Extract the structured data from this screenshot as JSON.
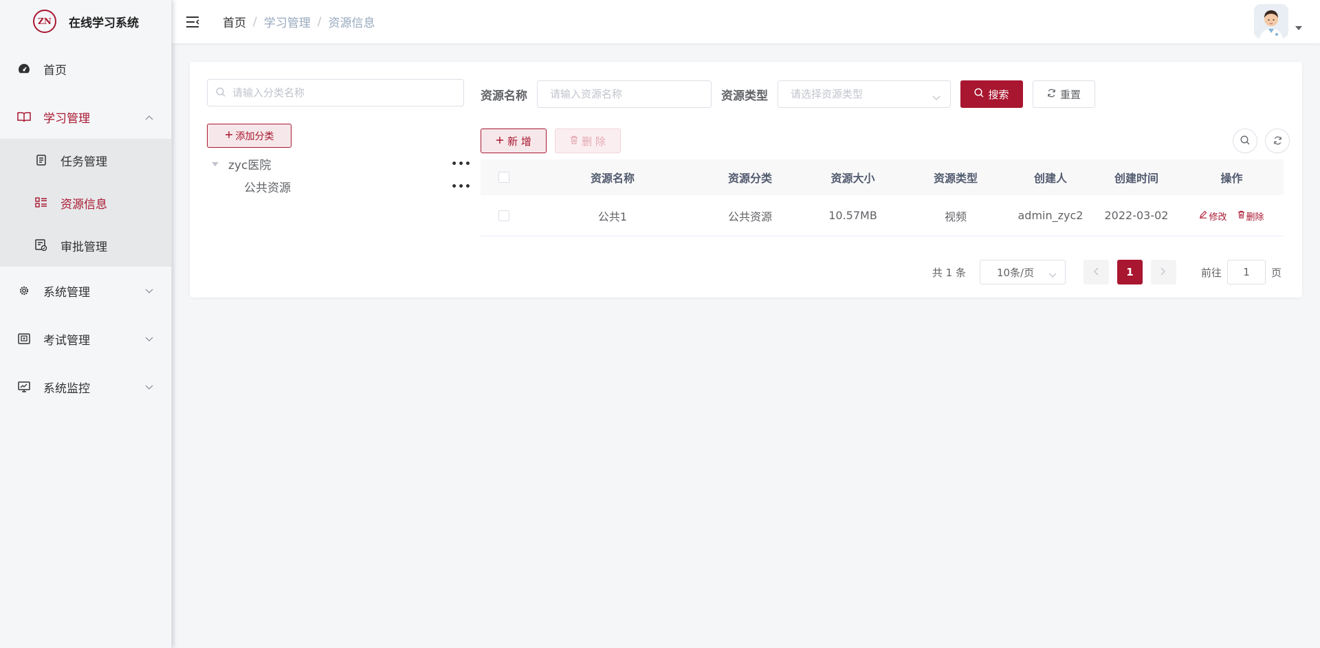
{
  "app": {
    "title": "在线学习系统",
    "logo_text": "ZN"
  },
  "colors": {
    "primary": "#a8162f",
    "sidebar_bg": "#f5f6f8",
    "page_bg": "#f5f6f8"
  },
  "sidebar": {
    "items": [
      {
        "label": "首页",
        "icon": "dashboard-icon"
      },
      {
        "label": "学习管理",
        "icon": "book-icon",
        "expanded": true,
        "children": [
          {
            "label": "任务管理",
            "icon": "task-icon"
          },
          {
            "label": "资源信息",
            "icon": "resource-icon",
            "active": true
          },
          {
            "label": "审批管理",
            "icon": "approval-icon"
          }
        ]
      },
      {
        "label": "系统管理",
        "icon": "gear-icon"
      },
      {
        "label": "考试管理",
        "icon": "exam-icon"
      },
      {
        "label": "系统监控",
        "icon": "monitor-icon"
      }
    ]
  },
  "breadcrumb": {
    "home": "首页",
    "sep": "/",
    "level2": "学习管理",
    "level3": "资源信息"
  },
  "tree": {
    "search_placeholder": "请输入分类名称",
    "add_button": "添加分类",
    "nodes": [
      {
        "label": "zyc医院",
        "dots": "•••"
      },
      {
        "label": "公共资源",
        "dots": "•••"
      }
    ]
  },
  "filters": {
    "name_label": "资源名称",
    "name_placeholder": "请输入资源名称",
    "type_label": "资源类型",
    "type_placeholder": "请选择资源类型",
    "search_button": "搜索",
    "reset_button": "重置"
  },
  "toolbar": {
    "new_button": "新 增",
    "delete_button": "删 除"
  },
  "table": {
    "headers": [
      "资源名称",
      "资源分类",
      "资源大小",
      "资源类型",
      "创建人",
      "创建时间",
      "操作"
    ],
    "rows": [
      {
        "name": "公共1",
        "category": "公共资源",
        "size": "10.57MB",
        "type": "视频",
        "creator": "admin_zyc2",
        "created": "2022-03-02",
        "edit": "修改",
        "delete": "删除"
      }
    ]
  },
  "pagination": {
    "total": "共 1 条",
    "page_size": "10条/页",
    "current": "1",
    "jump_prefix": "前往",
    "jump_value": "1",
    "jump_suffix": "页"
  }
}
